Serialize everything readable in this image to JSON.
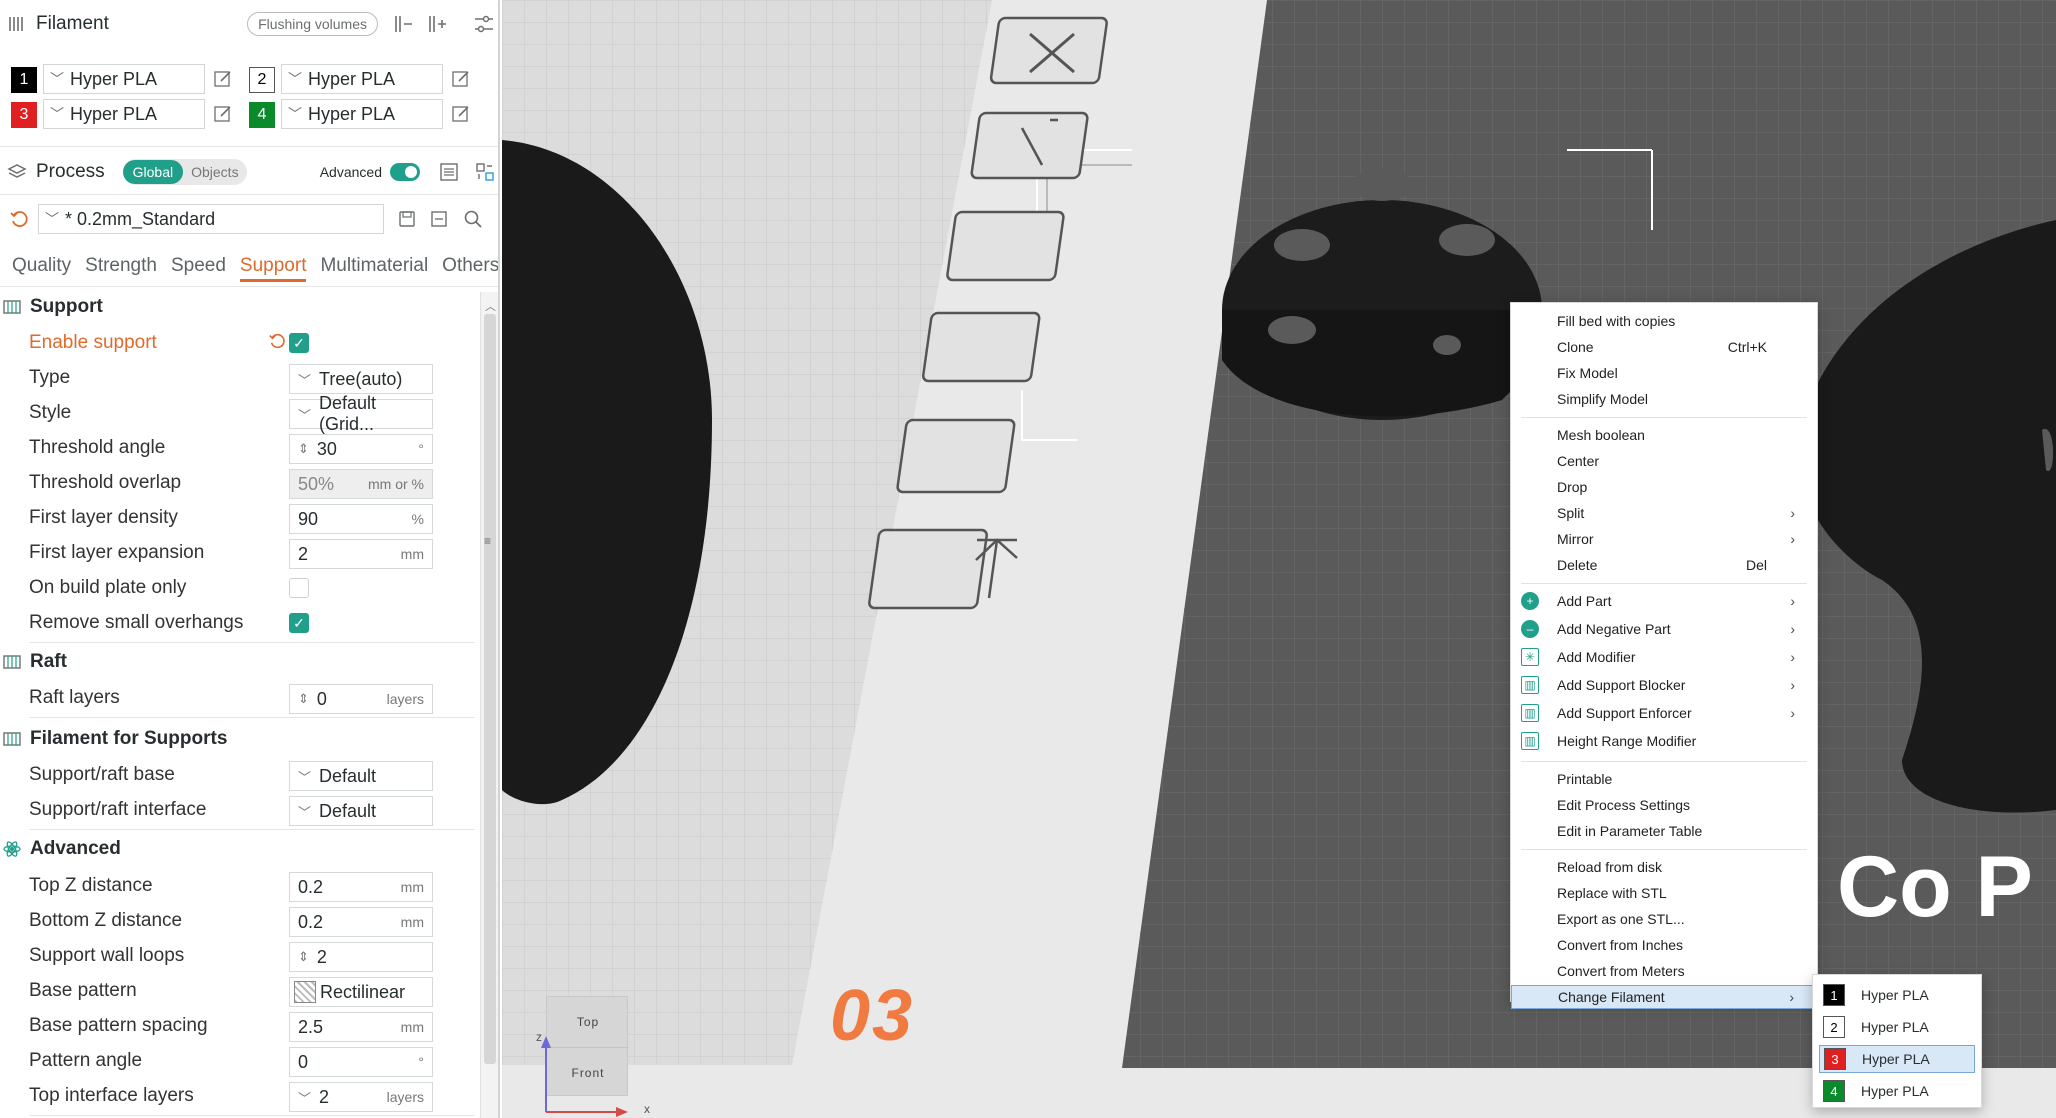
{
  "filament": {
    "title": "Filament",
    "flushing_label": "Flushing volumes",
    "slots": [
      {
        "num": "1",
        "name": "Hyper PLA",
        "color": "#000000",
        "text_color": "#ffffff"
      },
      {
        "num": "2",
        "name": "Hyper PLA",
        "color": "#ffffff",
        "text_color": "#000000"
      },
      {
        "num": "3",
        "name": "Hyper PLA",
        "color": "#e02020",
        "text_color": "#ffffff"
      },
      {
        "num": "4",
        "name": "Hyper PLA",
        "color": "#0a8a2a",
        "text_color": "#ffffff"
      }
    ]
  },
  "process": {
    "title": "Process",
    "global_label": "Global",
    "objects_label": "Objects",
    "advanced_label": "Advanced",
    "preset": "* 0.2mm_Standard"
  },
  "tabs": [
    "Quality",
    "Strength",
    "Speed",
    "Support",
    "Multimaterial",
    "Others"
  ],
  "support_section": {
    "title": "Support",
    "rows": [
      {
        "label": "Enable support",
        "type": "check",
        "checked": true,
        "highlight": true
      },
      {
        "label": "Type",
        "type": "combo",
        "value": "Tree(auto)"
      },
      {
        "label": "Style",
        "type": "combo",
        "value": "Default (Grid..."
      },
      {
        "label": "Threshold angle",
        "type": "spin",
        "value": "30",
        "unit": "°"
      },
      {
        "label": "Threshold overlap",
        "type": "text",
        "value": "50%",
        "unit": "mm or %",
        "disabled": true
      },
      {
        "label": "First layer density",
        "type": "text",
        "value": "90",
        "unit": "%"
      },
      {
        "label": "First layer expansion",
        "type": "text",
        "value": "2",
        "unit": "mm"
      },
      {
        "label": "On build plate only",
        "type": "check",
        "checked": false
      },
      {
        "label": "Remove small overhangs",
        "type": "check",
        "checked": true
      }
    ]
  },
  "raft_section": {
    "title": "Raft",
    "rows": [
      {
        "label": "Raft layers",
        "type": "spin",
        "value": "0",
        "unit": "layers"
      }
    ]
  },
  "filament_supports_section": {
    "title": "Filament for Supports",
    "rows": [
      {
        "label": "Support/raft base",
        "type": "combo",
        "value": "Default"
      },
      {
        "label": "Support/raft interface",
        "type": "combo",
        "value": "Default"
      }
    ]
  },
  "advanced_section": {
    "title": "Advanced",
    "rows": [
      {
        "label": "Top Z distance",
        "type": "text",
        "value": "0.2",
        "unit": "mm"
      },
      {
        "label": "Bottom Z distance",
        "type": "text",
        "value": "0.2",
        "unit": "mm"
      },
      {
        "label": "Support wall loops",
        "type": "spin",
        "value": "2",
        "unit": ""
      },
      {
        "label": "Base pattern",
        "type": "pattern",
        "value": "Rectilinear"
      },
      {
        "label": "Base pattern spacing",
        "type": "text",
        "value": "2.5",
        "unit": "mm"
      },
      {
        "label": "Pattern angle",
        "type": "text",
        "value": "0",
        "unit": "°"
      },
      {
        "label": "Top interface layers",
        "type": "combo",
        "value": "2",
        "unit": "layers"
      }
    ]
  },
  "viewport": {
    "plate_number": "03",
    "brand_text": "Co P",
    "cube_top": "Top",
    "cube_front": "Front",
    "axis_x": "x",
    "axis_z": "z"
  },
  "context_menu": {
    "groups": [
      [
        {
          "label": "Fill bed with copies"
        },
        {
          "label": "Clone",
          "shortcut": "Ctrl+K"
        },
        {
          "label": "Fix Model"
        },
        {
          "label": "Simplify Model"
        }
      ],
      [
        {
          "label": "Mesh boolean"
        },
        {
          "label": "Center"
        },
        {
          "label": "Drop"
        },
        {
          "label": "Split",
          "submenu": true
        },
        {
          "label": "Mirror",
          "submenu": true
        },
        {
          "label": "Delete",
          "shortcut": "Del"
        }
      ],
      [
        {
          "label": "Add Part",
          "submenu": true,
          "icon": "add-part-icon"
        },
        {
          "label": "Add Negative Part",
          "submenu": true,
          "icon": "add-negative-part-icon"
        },
        {
          "label": "Add Modifier",
          "submenu": true,
          "icon": "add-modifier-icon"
        },
        {
          "label": "Add Support Blocker",
          "submenu": true,
          "icon": "support-blocker-icon"
        },
        {
          "label": "Add Support Enforcer",
          "submenu": true,
          "icon": "support-enforcer-icon"
        },
        {
          "label": "Height Range Modifier",
          "icon": "height-range-icon"
        }
      ],
      [
        {
          "label": "Printable"
        },
        {
          "label": "Edit Process Settings"
        },
        {
          "label": "Edit in Parameter Table"
        }
      ],
      [
        {
          "label": "Reload from disk"
        },
        {
          "label": "Replace with STL"
        },
        {
          "label": "Export as one STL..."
        },
        {
          "label": "Convert from Inches"
        },
        {
          "label": "Convert from Meters"
        },
        {
          "label": "Change Filament",
          "submenu": true,
          "selected": true
        }
      ]
    ]
  },
  "filament_submenu": [
    {
      "num": "1",
      "label": "Hyper PLA"
    },
    {
      "num": "2",
      "label": "Hyper PLA"
    },
    {
      "num": "3",
      "label": "Hyper PLA",
      "selected": true
    },
    {
      "num": "4",
      "label": "Hyper PLA"
    }
  ]
}
